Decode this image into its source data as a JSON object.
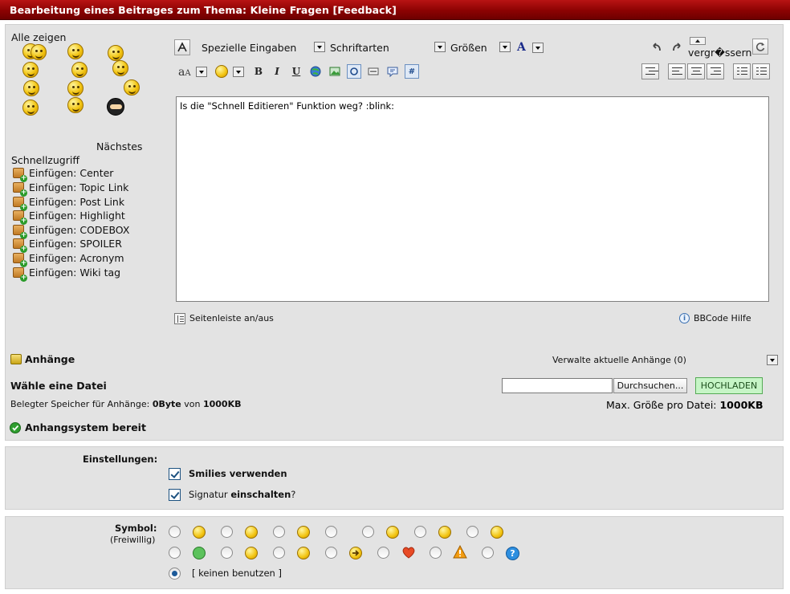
{
  "titlebar": {
    "title": "Bearbeitung eines Beitrages zum Thema: Kleine Fragen [Feedback]"
  },
  "smilies": {
    "show_all": "Alle zeigen"
  },
  "quickaccess": {
    "next": "Nächstes",
    "title": "Schnellzugriff",
    "items": [
      "Einfügen: Center",
      "Einfügen: Topic Link",
      "Einfügen: Post Link",
      "Einfügen: Highlight",
      "Einfügen: CODEBOX",
      "Einfügen: SPOILER",
      "Einfügen: Acronym",
      "Einfügen: Wiki tag"
    ]
  },
  "toolbar": {
    "special": "Spezielle Eingaben",
    "fonts": "Schriftarten",
    "sizes": "Größen",
    "enlarge": "vergr�ssern",
    "bold": "B",
    "italic": "I",
    "underline": "U",
    "color_glyph": "A",
    "numbering_glyph": "#"
  },
  "editor": {
    "text": "Is die \"Schnell Editieren\" Funktion weg? :blink:"
  },
  "footer": {
    "sidebar_toggle": "Seitenleiste an/aus",
    "bbcode_help": "BBCode Hilfe"
  },
  "attachments": {
    "title": "Anhänge",
    "manage": "Verwalte aktuelle Anhänge (0)",
    "choose_file": "Wähle eine Datei",
    "browse": "Durchsuchen...",
    "upload": "HOCHLADEN",
    "used_prefix": "Belegter Speicher für Anhänge: ",
    "used_value": "0Byte",
    "used_mid": " von ",
    "used_max": "1000KB",
    "max_prefix": "Max. Größe pro Datei: ",
    "max_value": "1000KB",
    "status": "Anhangsystem bereit"
  },
  "settings": {
    "label": "Einstellungen:",
    "smilies": "Smilies verwenden",
    "sig_prefix": "Signatur ",
    "sig_bold": "einschalten",
    "sig_suffix": "?"
  },
  "symbol": {
    "label": "Symbol:",
    "optional": "(Freiwillig)",
    "none": "[ keinen benutzen ]"
  }
}
